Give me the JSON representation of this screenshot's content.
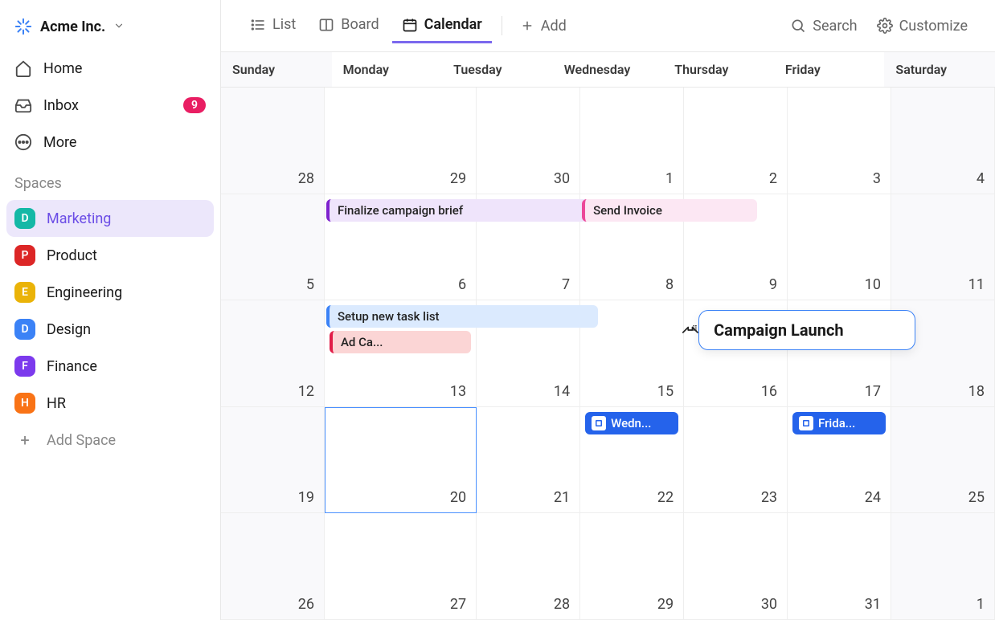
{
  "workspace": {
    "name": "Acme Inc."
  },
  "nav": {
    "home": "Home",
    "inbox": "Inbox",
    "inbox_count": "9",
    "more": "More"
  },
  "spaces_label": "Spaces",
  "spaces": [
    {
      "letter": "D",
      "label": "Marketing",
      "color": "#14b8a6",
      "active": true
    },
    {
      "letter": "P",
      "label": "Product",
      "color": "#dc2626"
    },
    {
      "letter": "E",
      "label": "Engineering",
      "color": "#eab308"
    },
    {
      "letter": "D",
      "label": "Design",
      "color": "#3b82f6"
    },
    {
      "letter": "F",
      "label": "Finance",
      "color": "#7c3aed"
    },
    {
      "letter": "H",
      "label": "HR",
      "color": "#f97316"
    }
  ],
  "add_space": "Add Space",
  "views": {
    "list": "List",
    "board": "Board",
    "calendar": "Calendar",
    "add": "Add",
    "search": "Search",
    "customize": "Customize"
  },
  "days": [
    "Sunday",
    "Monday",
    "Tuesday",
    "Wednesday",
    "Thursday",
    "Friday",
    "Saturday"
  ],
  "dates": [
    [
      28,
      29,
      30,
      1,
      2,
      3,
      4
    ],
    [
      5,
      6,
      7,
      8,
      9,
      10,
      11
    ],
    [
      12,
      13,
      14,
      15,
      16,
      17,
      18
    ],
    [
      19,
      20,
      21,
      22,
      23,
      24,
      25
    ],
    [
      26,
      27,
      28,
      29,
      30,
      31,
      1
    ]
  ],
  "events": {
    "finalize_brief": "Finalize campaign brief",
    "send_invoice": "Send Invoice",
    "setup_list": "Setup new task list",
    "ad_campaign": "Ad Ca...",
    "campaign_launch": "Campaign Launch",
    "wednesday_event": "Wedn...",
    "friday_event": "Frida..."
  }
}
